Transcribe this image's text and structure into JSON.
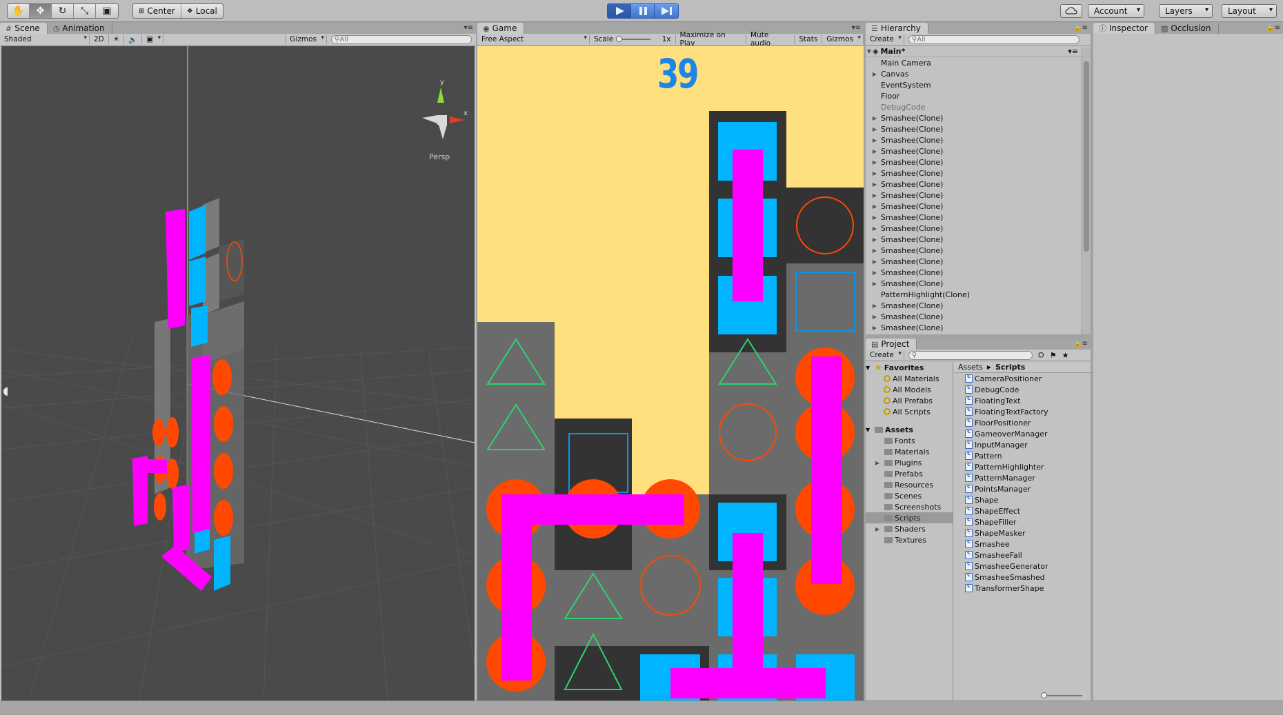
{
  "toolbar": {
    "tools": [
      "hand-icon",
      "move-icon",
      "rotate-icon",
      "scale-icon",
      "rect-icon"
    ],
    "pivot": "Center",
    "space": "Local",
    "account": "Account",
    "layers": "Layers",
    "layout": "Layout"
  },
  "scene": {
    "tab_scene": "Scene",
    "tab_animation": "Animation",
    "shading": "Shaded",
    "mode_2d": "2D",
    "gizmos": "Gizmos",
    "search_placeholder": "All",
    "persp": "Persp"
  },
  "game": {
    "tab": "Game",
    "aspect": "Free Aspect",
    "scale_label": "Scale",
    "scale_value": "1x",
    "maximize": "Maximize on Play",
    "mute": "Mute audio",
    "stats": "Stats",
    "gizmos": "Gizmos",
    "score": "39"
  },
  "hierarchy": {
    "tab": "Hierarchy",
    "create": "Create",
    "search_placeholder": "All",
    "scene_name": "Main*",
    "items": [
      {
        "label": "Main Camera",
        "arrow": ""
      },
      {
        "label": "Canvas",
        "arrow": "▶"
      },
      {
        "label": "EventSystem",
        "arrow": ""
      },
      {
        "label": "Floor",
        "arrow": ""
      },
      {
        "label": "DebugCode",
        "arrow": ""
      },
      {
        "label": "Smashee(Clone)",
        "arrow": "▶"
      },
      {
        "label": "Smashee(Clone)",
        "arrow": "▶"
      },
      {
        "label": "Smashee(Clone)",
        "arrow": "▶"
      },
      {
        "label": "Smashee(Clone)",
        "arrow": "▶"
      },
      {
        "label": "Smashee(Clone)",
        "arrow": "▶"
      },
      {
        "label": "Smashee(Clone)",
        "arrow": "▶"
      },
      {
        "label": "Smashee(Clone)",
        "arrow": "▶"
      },
      {
        "label": "Smashee(Clone)",
        "arrow": "▶"
      },
      {
        "label": "Smashee(Clone)",
        "arrow": "▶"
      },
      {
        "label": "Smashee(Clone)",
        "arrow": "▶"
      },
      {
        "label": "Smashee(Clone)",
        "arrow": "▶"
      },
      {
        "label": "Smashee(Clone)",
        "arrow": "▶"
      },
      {
        "label": "Smashee(Clone)",
        "arrow": "▶"
      },
      {
        "label": "Smashee(Clone)",
        "arrow": "▶"
      },
      {
        "label": "Smashee(Clone)",
        "arrow": "▶"
      },
      {
        "label": "Smashee(Clone)",
        "arrow": "▶"
      },
      {
        "label": "PatternHighlight(Clone)",
        "arrow": ""
      },
      {
        "label": "Smashee(Clone)",
        "arrow": "▶"
      },
      {
        "label": "Smashee(Clone)",
        "arrow": "▶"
      },
      {
        "label": "Smashee(Clone)",
        "arrow": "▶"
      }
    ]
  },
  "project": {
    "tab": "Project",
    "create": "Create",
    "favorites": "Favorites",
    "favorite_items": [
      "All Materials",
      "All Models",
      "All Prefabs",
      "All Scripts"
    ],
    "assets": "Assets",
    "asset_folders": [
      {
        "label": "Fonts",
        "arrow": ""
      },
      {
        "label": "Materials",
        "arrow": ""
      },
      {
        "label": "Plugins",
        "arrow": "▶"
      },
      {
        "label": "Prefabs",
        "arrow": ""
      },
      {
        "label": "Resources",
        "arrow": ""
      },
      {
        "label": "Scenes",
        "arrow": ""
      },
      {
        "label": "Screenshots",
        "arrow": ""
      },
      {
        "label": "Scripts",
        "arrow": ""
      },
      {
        "label": "Shaders",
        "arrow": "▶"
      },
      {
        "label": "Textures",
        "arrow": ""
      }
    ],
    "breadcrumb_root": "Assets",
    "breadcrumb_current": "Scripts",
    "scripts": [
      "CameraPositioner",
      "DebugCode",
      "FloatingText",
      "FloatingTextFactory",
      "FloorPositioner",
      "GameoverManager",
      "InputManager",
      "Pattern",
      "PatternHighlighter",
      "PatternManager",
      "PointsManager",
      "Shape",
      "ShapeEffect",
      "ShapeFiller",
      "ShapeMasker",
      "Smashee",
      "SmasheeFall",
      "SmasheeGenerator",
      "SmasheeSmashed",
      "TransformerShape"
    ]
  },
  "inspector": {
    "tab_inspector": "Inspector",
    "tab_occlusion": "Occlusion"
  },
  "colors": {
    "tile_gray": "#6b6b6b",
    "tile_dark": "#333333",
    "background_yellow": "#ffdf7e",
    "cyan": "#00b4ff",
    "orange": "#ff4800",
    "green": "#2dd36f",
    "magenta": "#ff00ff",
    "score_blue": "#1a86e8"
  }
}
